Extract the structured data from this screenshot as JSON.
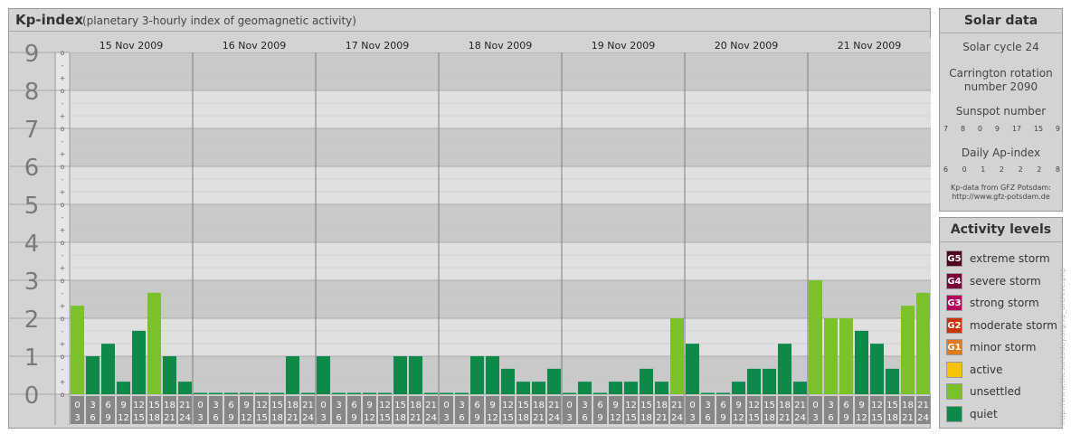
{
  "header": {
    "title": "Kp-index",
    "subtitle": "(planetary 3-hourly index of geomagnetic activity)"
  },
  "chart_data": {
    "type": "bar",
    "ylim": [
      0,
      9
    ],
    "y_ticks": [
      "0",
      "1",
      "2",
      "3",
      "4",
      "5",
      "6",
      "7",
      "8",
      "9"
    ],
    "sub_ticks": [
      "o",
      "+",
      "-"
    ],
    "days": [
      "15 Nov 2009",
      "16 Nov 2009",
      "17 Nov 2009",
      "18 Nov 2009",
      "19 Nov 2009",
      "20 Nov 2009",
      "21 Nov 2009"
    ],
    "interval_start": [
      "0",
      "3",
      "6",
      "9",
      "12",
      "15",
      "18",
      "21"
    ],
    "interval_end": [
      "3",
      "6",
      "9",
      "12",
      "15",
      "18",
      "21",
      "24"
    ],
    "values": [
      2.33,
      1,
      1.33,
      0.33,
      1.67,
      2.67,
      1,
      0.33,
      0,
      0,
      0,
      0,
      0,
      0,
      1,
      0,
      1,
      0,
      0,
      0,
      0,
      1,
      1,
      0,
      0,
      0,
      1,
      1,
      0.67,
      0.33,
      0.33,
      0.67,
      0,
      0.33,
      0,
      0.33,
      0.33,
      0.67,
      0.33,
      2,
      1.33,
      0,
      0,
      0.33,
      0.67,
      0.67,
      1.33,
      0.33,
      3,
      2,
      2,
      1.67,
      1.33,
      0.67,
      2.33,
      2.67
    ]
  },
  "solar_data": {
    "title": "Solar data",
    "cycle": "Solar cycle 24",
    "carrington_line1": "Carrington rotation",
    "carrington_line2": "number 2090",
    "sunspot_label": "Sunspot number",
    "sunspot_values": [
      "7",
      "8",
      "0",
      "9",
      "17",
      "15",
      "9"
    ],
    "ap_label": "Daily Ap-index",
    "ap_values": [
      "6",
      "0",
      "1",
      "2",
      "2",
      "2",
      "8"
    ],
    "source_line1": "Kp-data from GFZ Potsdam:",
    "source_line2": "http://www.gfz-potsdam.de"
  },
  "activity_levels": {
    "title": "Activity levels",
    "items": [
      {
        "badge": "G5",
        "label": "extreme storm",
        "color": "#4d0022"
      },
      {
        "badge": "G4",
        "label": "severe storm",
        "color": "#7a0038"
      },
      {
        "badge": "G3",
        "label": "strong storm",
        "color": "#b3005f"
      },
      {
        "badge": "G2",
        "label": "moderate storm",
        "color": "#cc3300"
      },
      {
        "badge": "G1",
        "label": "minor storm",
        "color": "#e07a1f"
      },
      {
        "badge": "",
        "label": "active",
        "color": "#f6c400"
      },
      {
        "badge": "",
        "label": "unsettled",
        "color": "#7ac12b"
      },
      {
        "badge": "",
        "label": "quiet",
        "color": "#0d8a4a"
      }
    ]
  },
  "watermark": "http://www.thesuntoday.org/kp_archive.php"
}
